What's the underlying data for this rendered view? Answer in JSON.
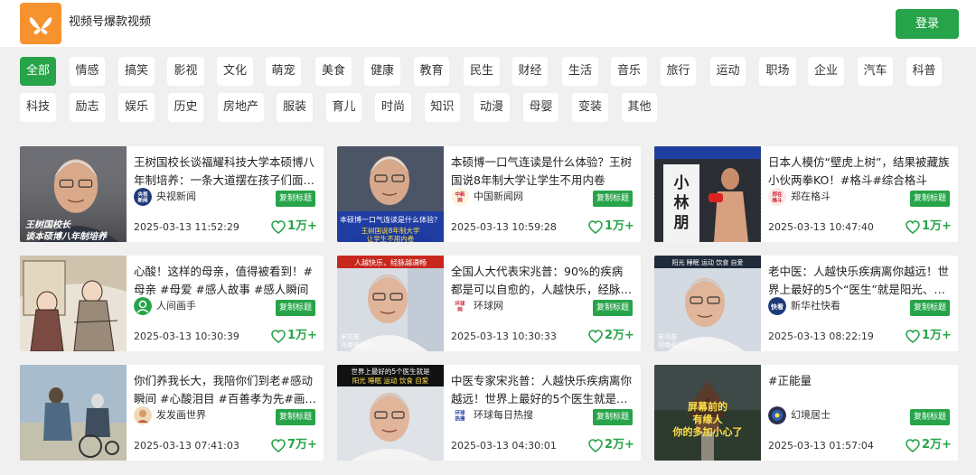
{
  "header": {
    "site_title": "视频号爆款视频",
    "login_label": "登录",
    "logo_icon": "butterfly-logo-icon",
    "accent": "#27a44a",
    "logo_color": "#f7932f"
  },
  "categories": [
    "全部",
    "情感",
    "搞笑",
    "影视",
    "文化",
    "萌宠",
    "美食",
    "健康",
    "教育",
    "民生",
    "财经",
    "生活",
    "音乐",
    "旅行",
    "运动",
    "职场",
    "企业",
    "汽车",
    "科普",
    "科技",
    "励志",
    "娱乐",
    "历史",
    "房地产",
    "服装",
    "育儿",
    "时尚",
    "知识",
    "动漫",
    "母婴",
    "变装",
    "其他"
  ],
  "active_category": "全部",
  "copy_label": "复制标题",
  "cards": [
    {
      "title": "王树国校长谈福耀科技大学本硕博八年制培养：一条大道摆在孩子们面…",
      "source": "央视新闻",
      "date": "2025-03-13 11:52:29",
      "likes": "1万+",
      "thumb_caption": "王树国校长谈本硕博八年制培养",
      "thumb_sub": "",
      "avatar_text": "央视新闻"
    },
    {
      "title": "本硕博一口气连读是什么体验？王树国说8年制大学让学生不用内卷",
      "source": "中国新闻网",
      "date": "2025-03-13 10:59:28",
      "likes": "1万+",
      "thumb_caption": "本硕博一口气连读是什么体验？",
      "thumb_sub": "王树国说8年制大学让学生不用内卷",
      "avatar_text": "中新网"
    },
    {
      "title": "日本人模仿“壁虎上树”，结果被藏族小伙两拳KO！#格斗#综合格斗",
      "source": "郑在格斗",
      "date": "2025-03-13 10:47:40",
      "likes": "1万+",
      "thumb_caption": "小林朋也",
      "thumb_sub": "",
      "avatar_text": "郑在格斗"
    },
    {
      "title": "心酸！这样的母亲，值得被看到！#母亲 #母爱 #感人故事 #感人瞬间",
      "source": "人间画手",
      "date": "2025-03-13 10:30:39",
      "likes": "1万+",
      "thumb_caption": "",
      "thumb_sub": "",
      "avatar_text": ""
    },
    {
      "title": "全国人大代表宋兆普：90%的疾病都是可以自愈的，人越快乐，经脉越…",
      "source": "环球网",
      "date": "2025-03-13 10:30:33",
      "likes": "2万+",
      "thumb_caption": "人越快乐，经脉越通畅",
      "thumb_sub": "宋兆普 河南省汝州",
      "avatar_text": "环球网"
    },
    {
      "title": "老中医：人越快乐疾病离你越远！世界上最好的5个“医生”就是阳光、…",
      "source": "新华社快看",
      "date": "2025-03-13 08:22:19",
      "likes": "1万+",
      "thumb_caption": "阳光 睡眠 运动 饮食 自爱",
      "thumb_sub": "宋兆普 河南省汝州",
      "avatar_text": "快看"
    },
    {
      "title": "你们养我长大，我陪你们到老#感动瞬间 #心酸泪目 #百善孝为先#画一个…",
      "source": "发发画世界",
      "date": "2025-03-13 07:41:03",
      "likes": "7万+",
      "thumb_caption": "",
      "thumb_sub": "",
      "avatar_text": ""
    },
    {
      "title": "中医专家宋兆普：人越快乐疾病离你越远！世界上最好的5个医生就是阳…",
      "source": "环球每日热搜",
      "date": "2025-03-13 04:30:01",
      "likes": "2万+",
      "thumb_caption": "世界上最好的5个医生就是",
      "thumb_sub": "阳光 睡眠 运动 饮食 自爱",
      "avatar_text": "环球热搜"
    },
    {
      "title": "#正能量",
      "source": "幻境居士",
      "date": "2025-03-13 01:57:04",
      "likes": "2万+",
      "thumb_caption": "屏幕前的有缘人你的多加小心了",
      "thumb_sub": "",
      "avatar_text": ""
    }
  ]
}
